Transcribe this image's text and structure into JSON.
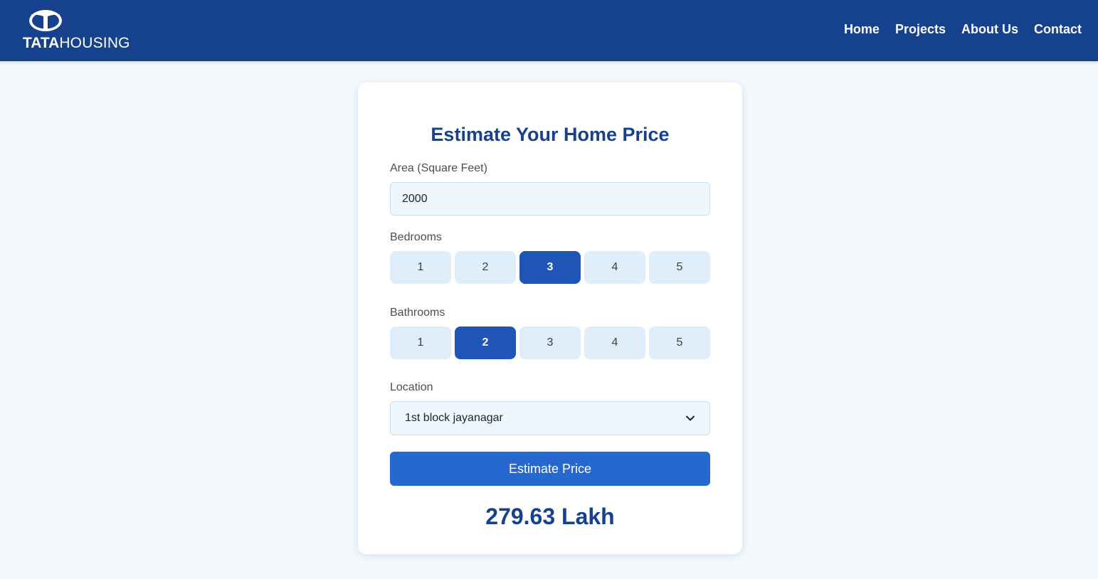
{
  "header": {
    "brand_bold": "TATA",
    "brand_light": "HOUSING",
    "logo_icon": "tata-logo-icon",
    "nav": [
      {
        "label": "Home"
      },
      {
        "label": "Projects"
      },
      {
        "label": "About Us"
      },
      {
        "label": "Contact"
      }
    ],
    "background_color": "#16418c"
  },
  "form": {
    "title": "Estimate Your Home Price",
    "area": {
      "label": "Area (Square Feet)",
      "value": "2000"
    },
    "bedrooms": {
      "label": "Bedrooms",
      "options": [
        "1",
        "2",
        "3",
        "4",
        "5"
      ],
      "selected": "3"
    },
    "bathrooms": {
      "label": "Bathrooms",
      "options": [
        "1",
        "2",
        "3",
        "4",
        "5"
      ],
      "selected": "2"
    },
    "location": {
      "label": "Location",
      "value": "1st block jayanagar",
      "icon": "chevron-down-icon"
    },
    "submit_label": "Estimate Price",
    "result": "279.63 Lakh"
  },
  "colors": {
    "primary": "#16418c",
    "accent": "#2767d0",
    "selected_option": "#1f55b5",
    "option_bg": "#e0eefc",
    "page_bg": "#f2f8fc"
  }
}
